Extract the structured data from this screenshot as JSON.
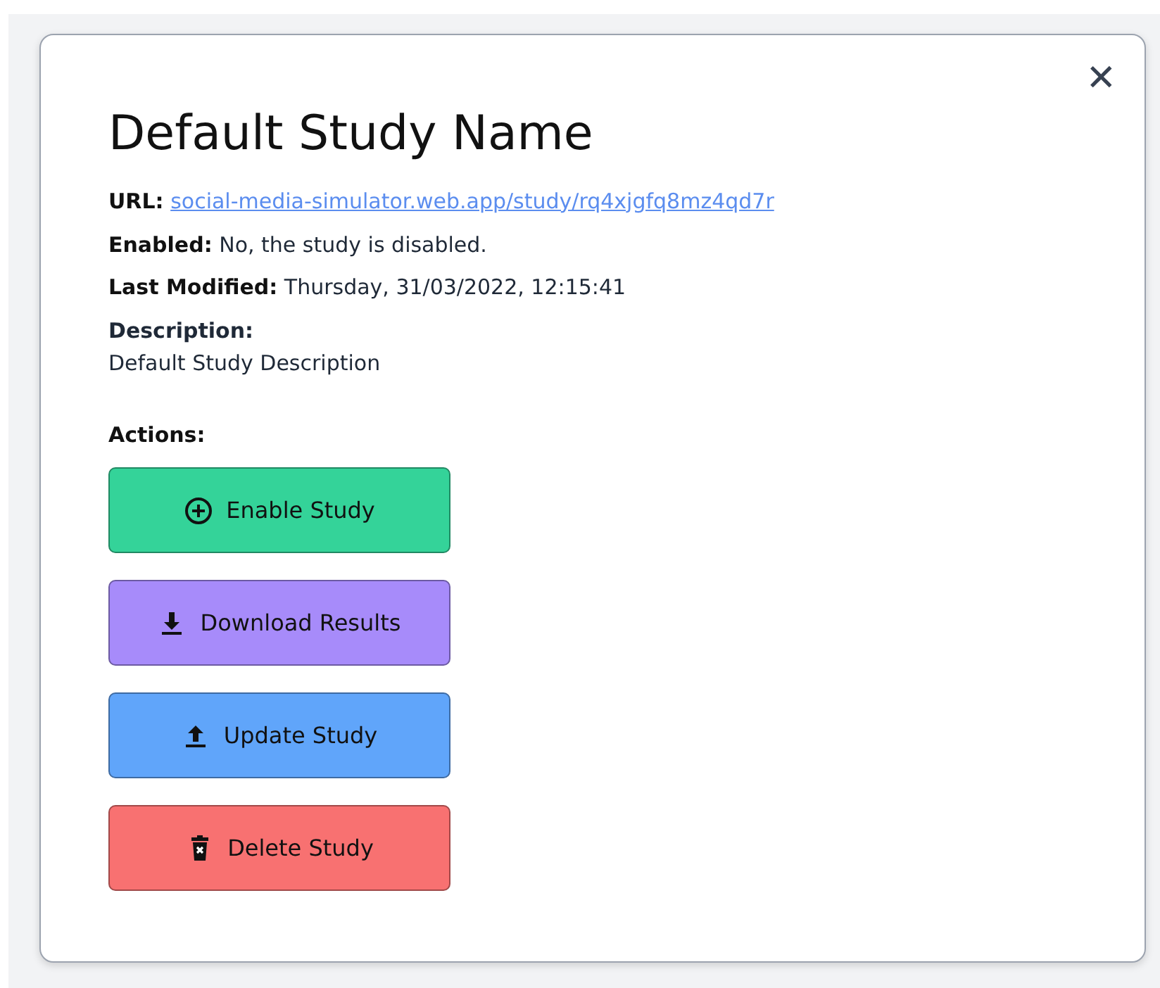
{
  "dialog": {
    "title": "Default Study Name",
    "close": "✕"
  },
  "fields": [
    {
      "kind": "link",
      "label": "URL:",
      "value": "social-media-simulator.web.app/study/rq4xjgfq8mz4qd7r"
    },
    {
      "kind": "inline",
      "label": "Enabled:",
      "value": "No, the study is disabled."
    },
    {
      "kind": "inline",
      "label": "Last Modified:",
      "value": "Thursday, 31/03/2022, 12:15:41"
    },
    {
      "kind": "block",
      "label": "Description:",
      "value": "Default Study Description"
    }
  ],
  "actions": {
    "label": "Actions:",
    "buttons": [
      {
        "kind": "enable",
        "label": "Enable Study"
      },
      {
        "kind": "download",
        "label": "Download Results"
      },
      {
        "kind": "update",
        "label": "Update Study"
      },
      {
        "kind": "delete",
        "label": "Delete Study"
      }
    ]
  }
}
